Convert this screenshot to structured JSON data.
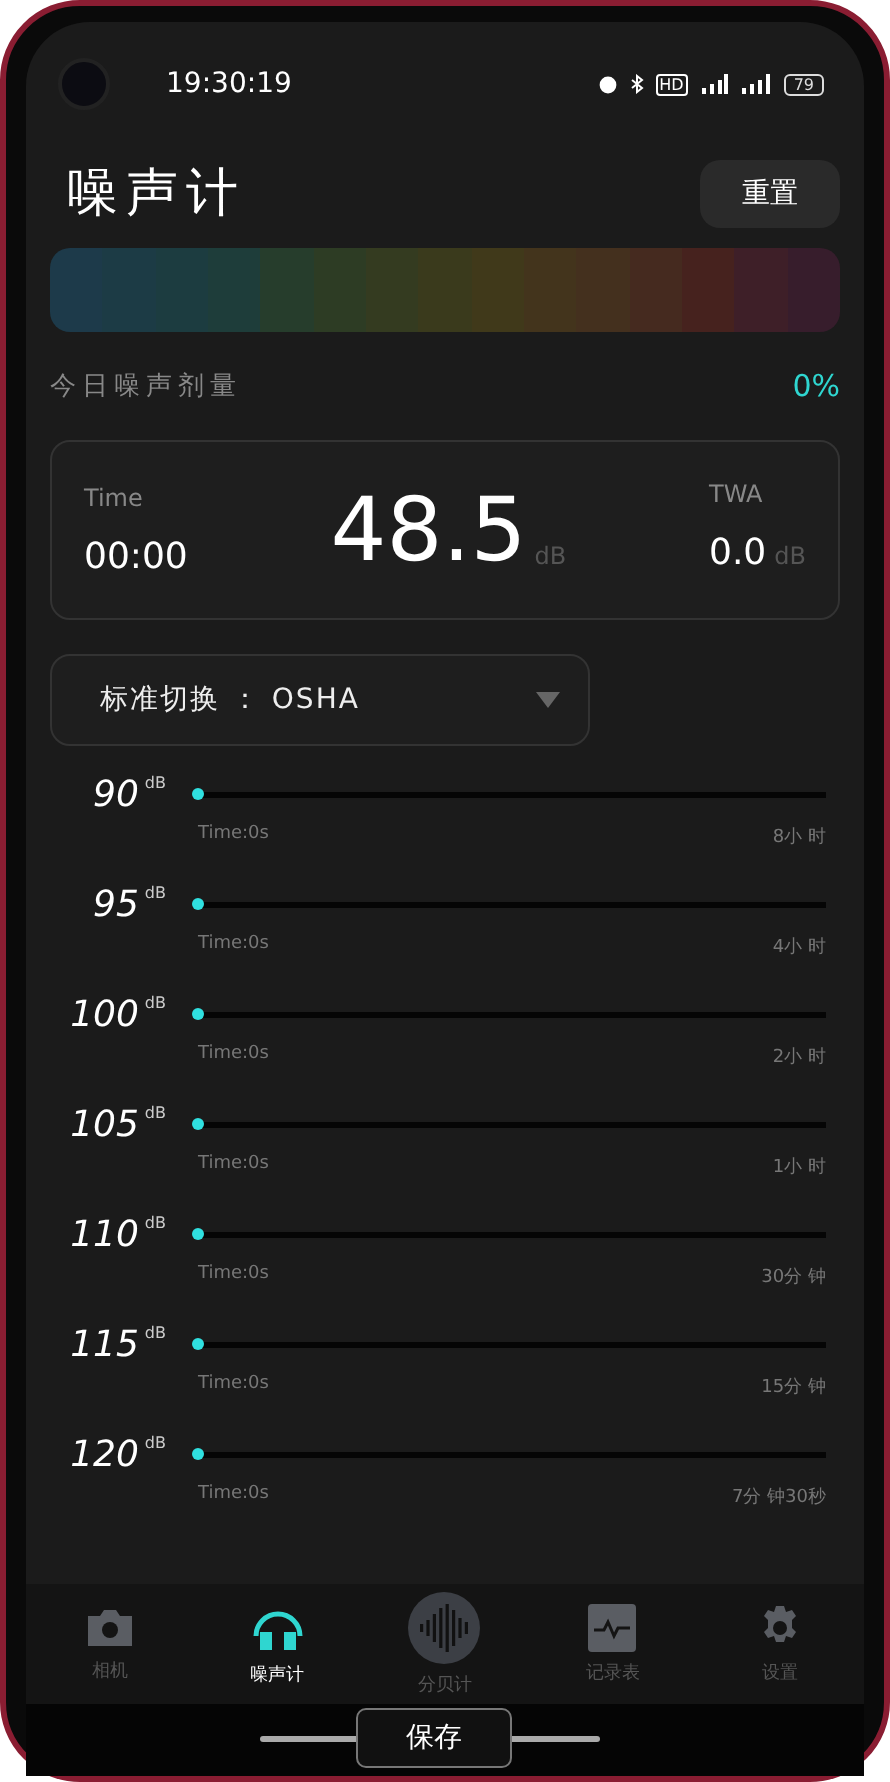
{
  "status_bar": {
    "time": "19:30:19",
    "indicators": [
      "HD"
    ],
    "battery": "79"
  },
  "header": {
    "title": "噪声计",
    "reset_button": "重置"
  },
  "dose": {
    "label": "今日噪声剂量",
    "value": "0%"
  },
  "readout": {
    "time_label": "Time",
    "time": "00:00",
    "level": "48.5",
    "level_unit": "dB",
    "twa_label": "TWA",
    "twa": "0.0",
    "twa_unit": "dB"
  },
  "standard": {
    "label": "标准切换",
    "separator": "：",
    "value": "OSHA"
  },
  "limits": [
    {
      "db": "90",
      "unit": "dB",
      "time": "Time:0s",
      "limit": "8小 时",
      "level": 0
    },
    {
      "db": "95",
      "unit": "dB",
      "time": "Time:0s",
      "limit": "4小 时",
      "level": 0
    },
    {
      "db": "100",
      "unit": "dB",
      "time": "Time:0s",
      "limit": "2小 时",
      "level": 0
    },
    {
      "db": "105",
      "unit": "dB",
      "time": "Time:0s",
      "limit": "1小 时",
      "level": 0
    },
    {
      "db": "110",
      "unit": "dB",
      "time": "Time:0s",
      "limit": "30分 钟",
      "level": 0
    },
    {
      "db": "115",
      "unit": "dB",
      "time": "Time:0s",
      "limit": "15分 钟",
      "level": 0
    },
    {
      "db": "120",
      "unit": "dB",
      "time": "Time:0s",
      "limit": "7分 钟30秒",
      "level": 0
    }
  ],
  "nav": [
    {
      "kind": "camera",
      "label": "相机",
      "selected": false
    },
    {
      "kind": "headphones",
      "label": "噪声计",
      "selected": true
    },
    {
      "kind": "wave",
      "label": "分贝计",
      "selected": false
    },
    {
      "kind": "chart",
      "label": "记录表",
      "selected": false
    },
    {
      "kind": "gear",
      "label": "设置",
      "selected": false
    }
  ],
  "save_button": "保存"
}
